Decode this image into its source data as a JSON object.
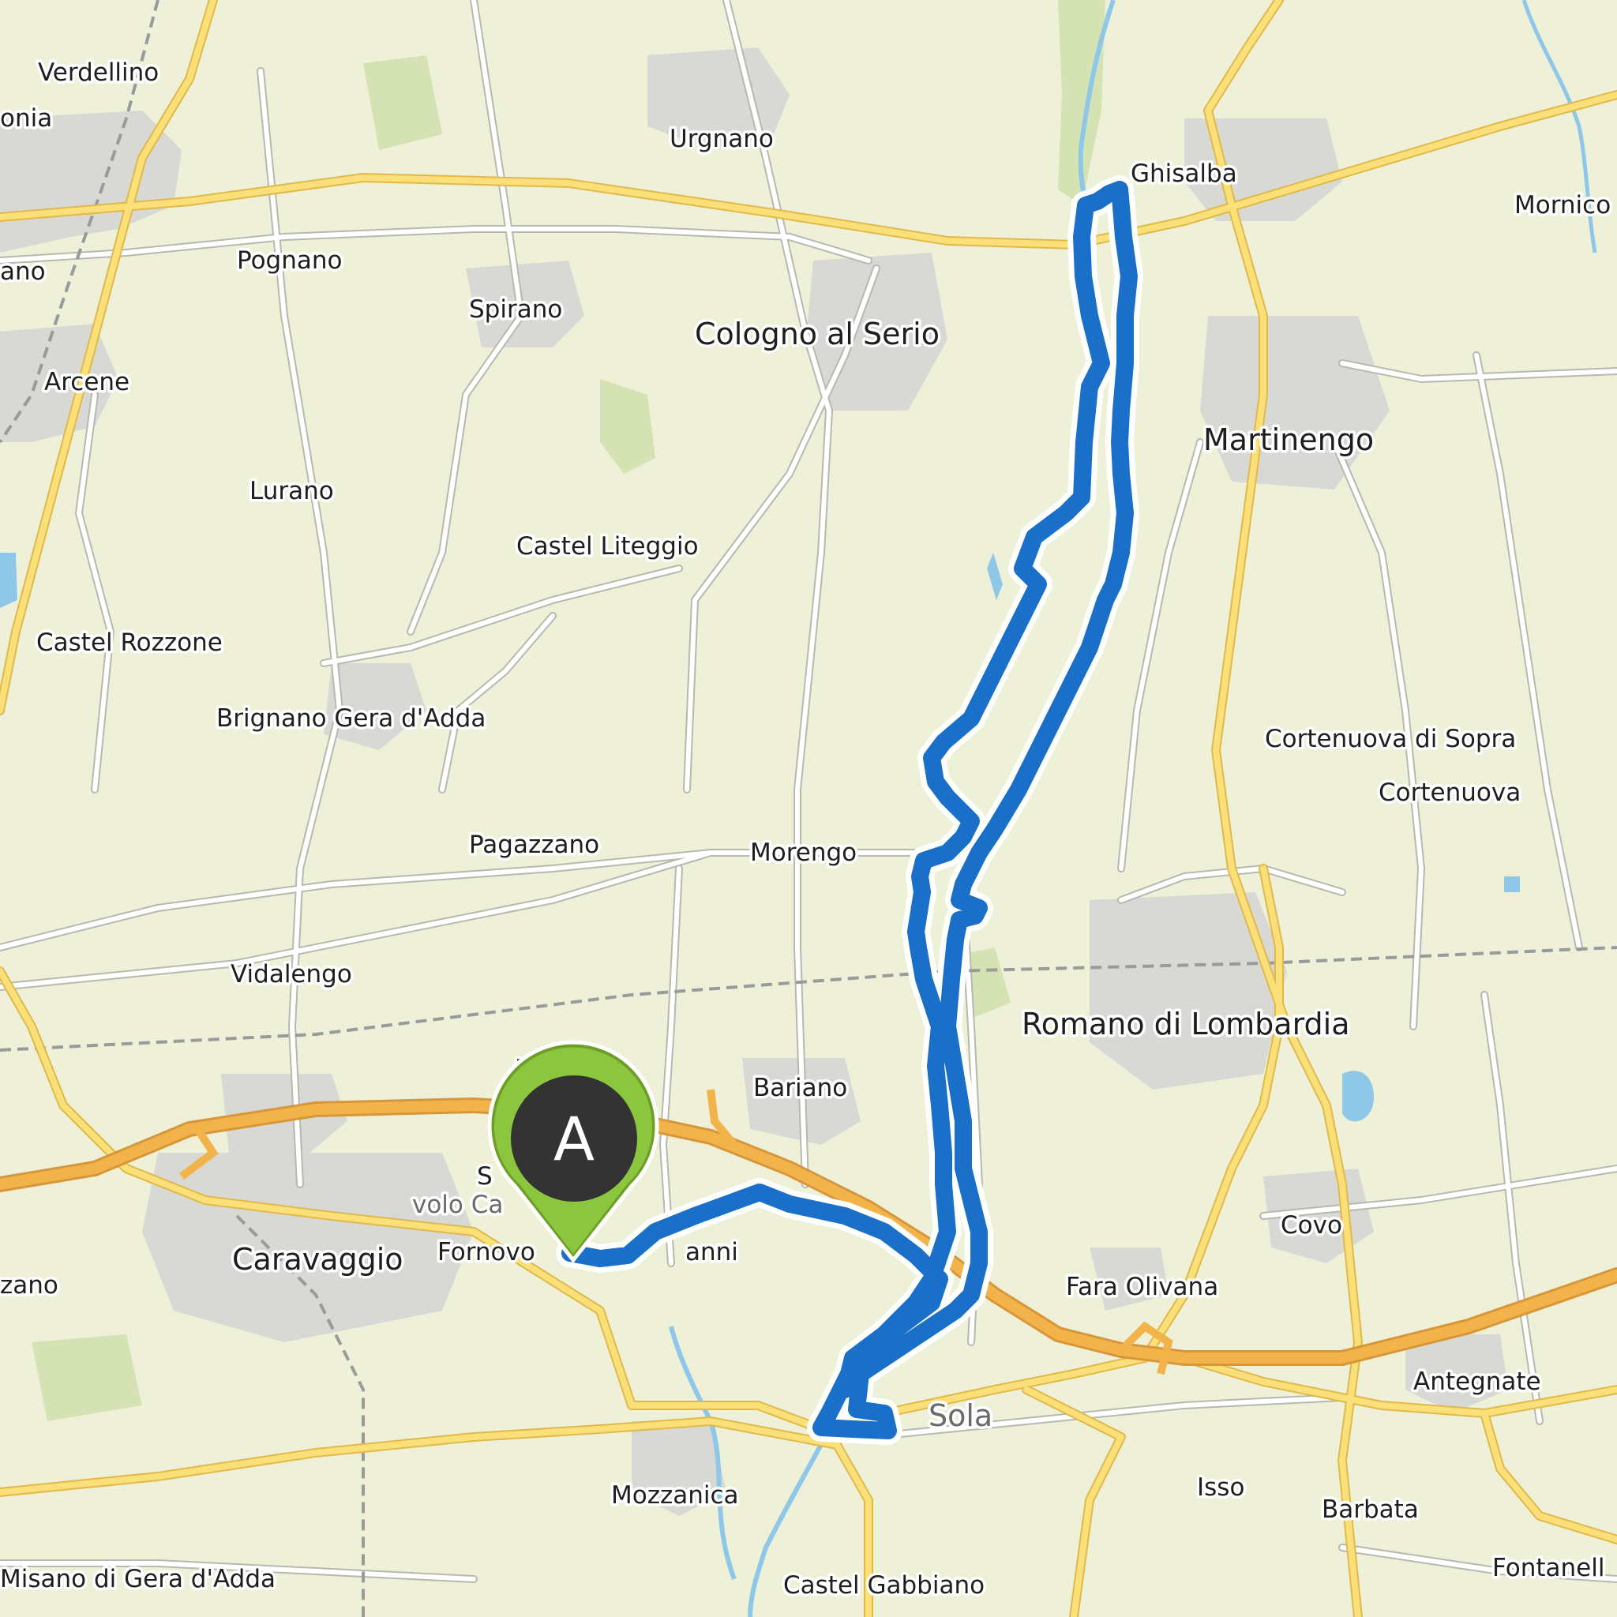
{
  "map": {
    "marker": {
      "letter": "A",
      "fill": "#8cc63e",
      "inner": "#333333"
    },
    "route": {
      "color": "#1a70c8",
      "casing": "#ffffff"
    },
    "colors": {
      "land": "#eef0d8",
      "urban": "#d8d8d4",
      "park": "#d5e3b4",
      "water": "#8ec7e8",
      "motorway": "#f2b44a",
      "primary": "#fbe07a",
      "minor": "#ffffff",
      "railway": "#9a9a9a"
    },
    "places": {
      "verdellino": "Verdellino",
      "onia": "onia",
      "urgnano": "Urgnano",
      "ghisalba": "Ghisalba",
      "mornico": "Mornico",
      "ano": "ano",
      "pognano": "Pognano",
      "spirano": "Spirano",
      "cologno": "Cologno al Serio",
      "arcene": "Arcene",
      "martinengo": "Martinengo",
      "lurano": "Lurano",
      "castel_liteggio": "Castel Liteggio",
      "castel_rozzone": "Castel Rozzone",
      "brignano": "Brignano Gera d'Adda",
      "cortenuova_sopra": "Cortenuova di Sopra",
      "cortenuova": "Cortenuova",
      "pagazzano": "Pagazzano",
      "morengo": "Morengo",
      "vidalengo": "Vidalengo",
      "romano": "Romano di Lombardia",
      "bariano": "Bariano",
      "caravaggio": "Caravaggio",
      "fornovo": "Fornovo",
      "anni": "anni",
      "volo_ca": "volo Ca",
      "s": "S",
      "m": "M",
      "zano": "zano",
      "covo": "Covo",
      "fara_olivana": "Fara Olivana",
      "antegnate": "Antegnate",
      "sola": "Sola",
      "mozzanica": "Mozzanica",
      "isso": "Isso",
      "barbata": "Barbata",
      "misano": "Misano di Gera d'Adda",
      "castel_gabbiano": "Castel Gabbiano",
      "fontanell": "Fontanell"
    }
  }
}
